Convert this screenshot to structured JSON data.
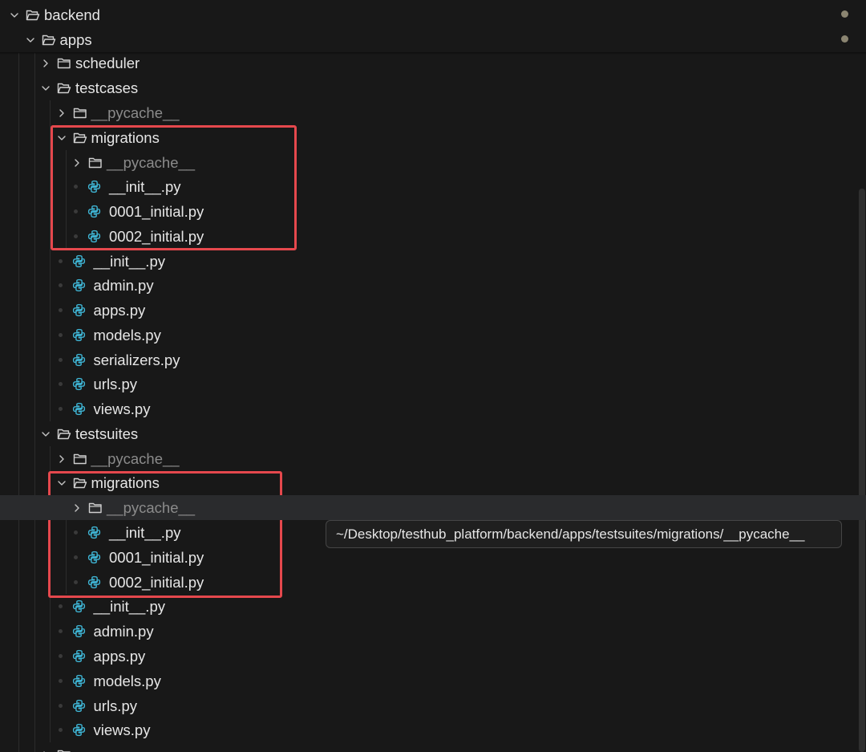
{
  "explorer": {
    "tree": [
      {
        "label": "backend",
        "type": "folder",
        "expanded": true,
        "modified": true
      },
      {
        "label": "apps",
        "type": "folder",
        "expanded": true,
        "modified": true
      },
      {
        "label": "scheduler",
        "type": "folder",
        "expanded": false
      },
      {
        "label": "testcases",
        "type": "folder",
        "expanded": true
      },
      {
        "label": "__pycache__",
        "type": "folder",
        "expanded": false,
        "dimmed": true
      },
      {
        "label": "migrations",
        "type": "folder",
        "expanded": true
      },
      {
        "label": "__pycache__",
        "type": "folder",
        "expanded": false,
        "dimmed": true
      },
      {
        "label": "__init__.py",
        "type": "python"
      },
      {
        "label": "0001_initial.py",
        "type": "python"
      },
      {
        "label": "0002_initial.py",
        "type": "python"
      },
      {
        "label": "__init__.py",
        "type": "python"
      },
      {
        "label": "admin.py",
        "type": "python"
      },
      {
        "label": "apps.py",
        "type": "python"
      },
      {
        "label": "models.py",
        "type": "python"
      },
      {
        "label": "serializers.py",
        "type": "python"
      },
      {
        "label": "urls.py",
        "type": "python"
      },
      {
        "label": "views.py",
        "type": "python"
      },
      {
        "label": "testsuites",
        "type": "folder",
        "expanded": true
      },
      {
        "label": "__pycache__",
        "type": "folder",
        "expanded": false,
        "dimmed": true
      },
      {
        "label": "migrations",
        "type": "folder",
        "expanded": true
      },
      {
        "label": "__pycache__",
        "type": "folder",
        "expanded": false,
        "dimmed": true,
        "hovered": true
      },
      {
        "label": "__init__.py",
        "type": "python"
      },
      {
        "label": "0001_initial.py",
        "type": "python"
      },
      {
        "label": "0002_initial.py",
        "type": "python"
      },
      {
        "label": "__init__.py",
        "type": "python"
      },
      {
        "label": "admin.py",
        "type": "python"
      },
      {
        "label": "apps.py",
        "type": "python"
      },
      {
        "label": "models.py",
        "type": "python"
      },
      {
        "label": "urls.py",
        "type": "python"
      },
      {
        "label": "views.py",
        "type": "python"
      },
      {
        "label": "",
        "type": "folder",
        "expanded": false
      }
    ]
  },
  "tooltip": {
    "text": "~/Desktop/testhub_platform/backend/apps/testsuites/migrations/__pycache__"
  },
  "colors": {
    "background": "#181818",
    "text": "#e6e6e6",
    "dimmed_text": "#8b8b8b",
    "python_icon": "#3fb6d6",
    "modified_dot": "#8b8571",
    "highlight_border": "#e5484d",
    "hover_row": "#2a2b2d"
  },
  "icons": {
    "folder_closed": "folder-icon",
    "folder_open": "folder-open-icon",
    "python_file": "python-file-icon",
    "chevron_right": "chevron-right-icon",
    "chevron_down": "chevron-down-icon"
  }
}
